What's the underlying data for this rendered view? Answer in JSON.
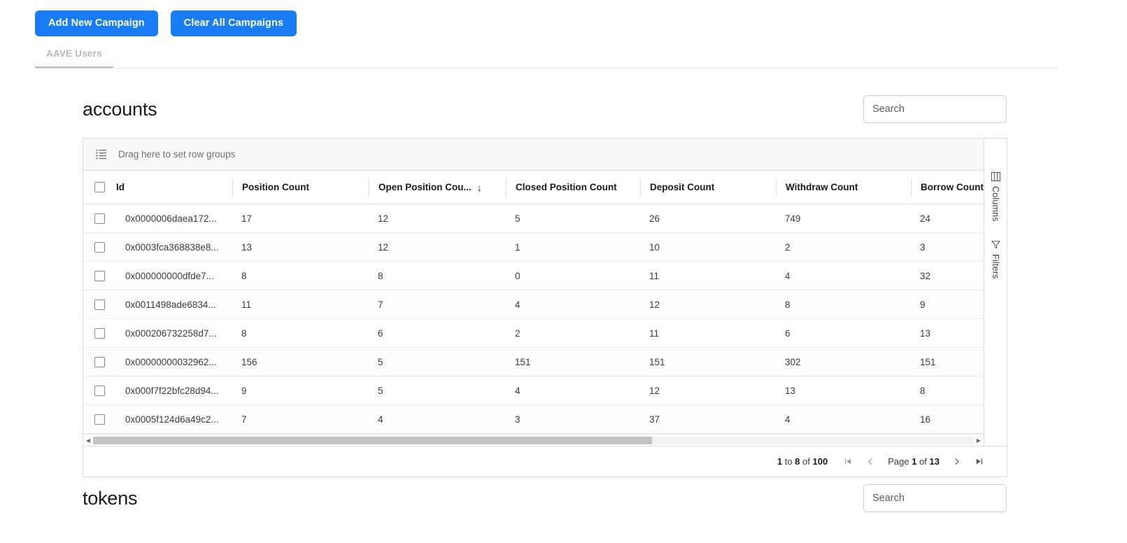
{
  "toolbar": {
    "add_campaign_label": "Add New Campaign",
    "clear_campaigns_label": "Clear All Campaigns",
    "accent_color": "#1a7cf5"
  },
  "tabs": [
    {
      "label": "AAVE Users",
      "active": true
    }
  ],
  "sections": [
    {
      "title": "accounts",
      "search": {
        "value": "",
        "placeholder": "Search"
      },
      "grid": {
        "row_group_placeholder": "Drag here to set row groups",
        "row_group_icon": "row-group-icon",
        "columns": [
          {
            "key": "id",
            "label": "Id",
            "sort": null
          },
          {
            "key": "position_count",
            "label": "Position Count",
            "sort": null
          },
          {
            "key": "open_position_count",
            "label": "Open Position Cou...",
            "sort": "desc",
            "sort_glyph": "↓"
          },
          {
            "key": "closed_position_count",
            "label": "Closed Position Count",
            "sort": null
          },
          {
            "key": "deposit_count",
            "label": "Deposit Count",
            "sort": null
          },
          {
            "key": "withdraw_count",
            "label": "Withdraw Count",
            "sort": null
          },
          {
            "key": "borrow_count",
            "label": "Borrow Count",
            "sort": null
          }
        ],
        "rows": [
          {
            "id": "0x0000006daea172...",
            "position_count": "17",
            "open_position_count": "12",
            "closed_position_count": "5",
            "deposit_count": "26",
            "withdraw_count": "749",
            "borrow_count": "24"
          },
          {
            "id": "0x0003fca368838e8...",
            "position_count": "13",
            "open_position_count": "12",
            "closed_position_count": "1",
            "deposit_count": "10",
            "withdraw_count": "2",
            "borrow_count": "3"
          },
          {
            "id": "0x000000000dfde7...",
            "position_count": "8",
            "open_position_count": "8",
            "closed_position_count": "0",
            "deposit_count": "11",
            "withdraw_count": "4",
            "borrow_count": "32"
          },
          {
            "id": "0x0011498ade6834...",
            "position_count": "11",
            "open_position_count": "7",
            "closed_position_count": "4",
            "deposit_count": "12",
            "withdraw_count": "8",
            "borrow_count": "9"
          },
          {
            "id": "0x000206732258d7...",
            "position_count": "8",
            "open_position_count": "6",
            "closed_position_count": "2",
            "deposit_count": "11",
            "withdraw_count": "6",
            "borrow_count": "13"
          },
          {
            "id": "0x00000000032962...",
            "position_count": "156",
            "open_position_count": "5",
            "closed_position_count": "151",
            "deposit_count": "151",
            "withdraw_count": "302",
            "borrow_count": "151"
          },
          {
            "id": "0x000f7f22bfc28d94...",
            "position_count": "9",
            "open_position_count": "5",
            "closed_position_count": "4",
            "deposit_count": "12",
            "withdraw_count": "13",
            "borrow_count": "8"
          },
          {
            "id": "0x0005f124d6a49c2...",
            "position_count": "7",
            "open_position_count": "4",
            "closed_position_count": "3",
            "deposit_count": "37",
            "withdraw_count": "4",
            "borrow_count": "16"
          }
        ],
        "tool_panel": [
          {
            "label": "Columns",
            "icon": "columns-icon"
          },
          {
            "label": "Filters",
            "icon": "filter-icon"
          }
        ],
        "pagination": {
          "range_prefix": "1",
          "range_to": "to",
          "range_end": "8",
          "range_of": "of",
          "total": "100",
          "page_word": "Page",
          "page_current": "1",
          "page_of": "of",
          "page_total": "13",
          "first_glyph": "⏮",
          "prev_glyph": "‹",
          "next_glyph": "›",
          "last_glyph": "⏭"
        }
      }
    },
    {
      "title": "tokens",
      "search": {
        "value": "",
        "placeholder": "Search"
      }
    }
  ]
}
